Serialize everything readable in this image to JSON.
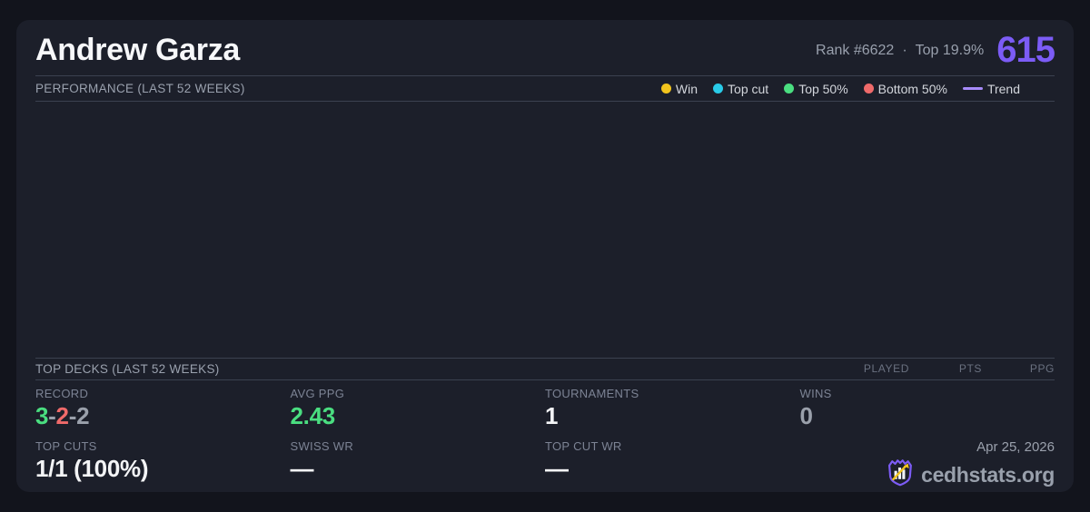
{
  "header": {
    "player_name": "Andrew Garza",
    "rank": "Rank #6622",
    "separator": "·",
    "percentile": "Top 19.9%",
    "elo": "615"
  },
  "colors": {
    "accent_purple": "#7c5cf6",
    "trend_lavender": "#a78bfa",
    "win_yellow": "#f2c41d",
    "topcut_cyan": "#29cbe8",
    "top50_green": "#4ade80",
    "bottom50_red": "#ef6a6a",
    "neutral_gray": "#9aa0ab",
    "value_red": "#ef6a6a",
    "value_green": "#4ade80"
  },
  "performance": {
    "title": "PERFORMANCE (LAST 52 WEEKS)",
    "chart_empty": true,
    "legend": [
      {
        "label": "Win",
        "color": "#f2c41d",
        "swatch": "dot"
      },
      {
        "label": "Top cut",
        "color": "#29cbe8",
        "swatch": "dot"
      },
      {
        "label": "Top 50%",
        "color": "#4ade80",
        "swatch": "dot"
      },
      {
        "label": "Bottom 50%",
        "color": "#ef6a6a",
        "swatch": "dot"
      },
      {
        "label": "Trend",
        "color": "#a78bfa",
        "swatch": "line"
      }
    ]
  },
  "top_decks": {
    "title": "TOP DECKS (LAST 52 WEEKS)",
    "columns": {
      "played": "PLAYED",
      "pts": "PTS",
      "ppg": "PPG"
    },
    "rows": []
  },
  "stats": {
    "record": {
      "label": "RECORD",
      "wins": "3",
      "losses": "2",
      "draws": "2",
      "dash": "-"
    },
    "avg_ppg": {
      "label": "AVG PPG",
      "value": "2.43"
    },
    "tournaments": {
      "label": "TOURNAMENTS",
      "value": "1"
    },
    "wins": {
      "label": "WINS",
      "value": "0"
    },
    "top_cuts": {
      "label": "TOP CUTS",
      "value": "1/1 (100%)"
    },
    "swiss_wr": {
      "label": "SWISS WR",
      "value": "—"
    },
    "top_cut_wr": {
      "label": "TOP CUT WR",
      "value": "—"
    }
  },
  "footer": {
    "date": "Apr 25, 2026",
    "site": "cedhstats.org",
    "logo": "cedhstats-crest-icon"
  }
}
